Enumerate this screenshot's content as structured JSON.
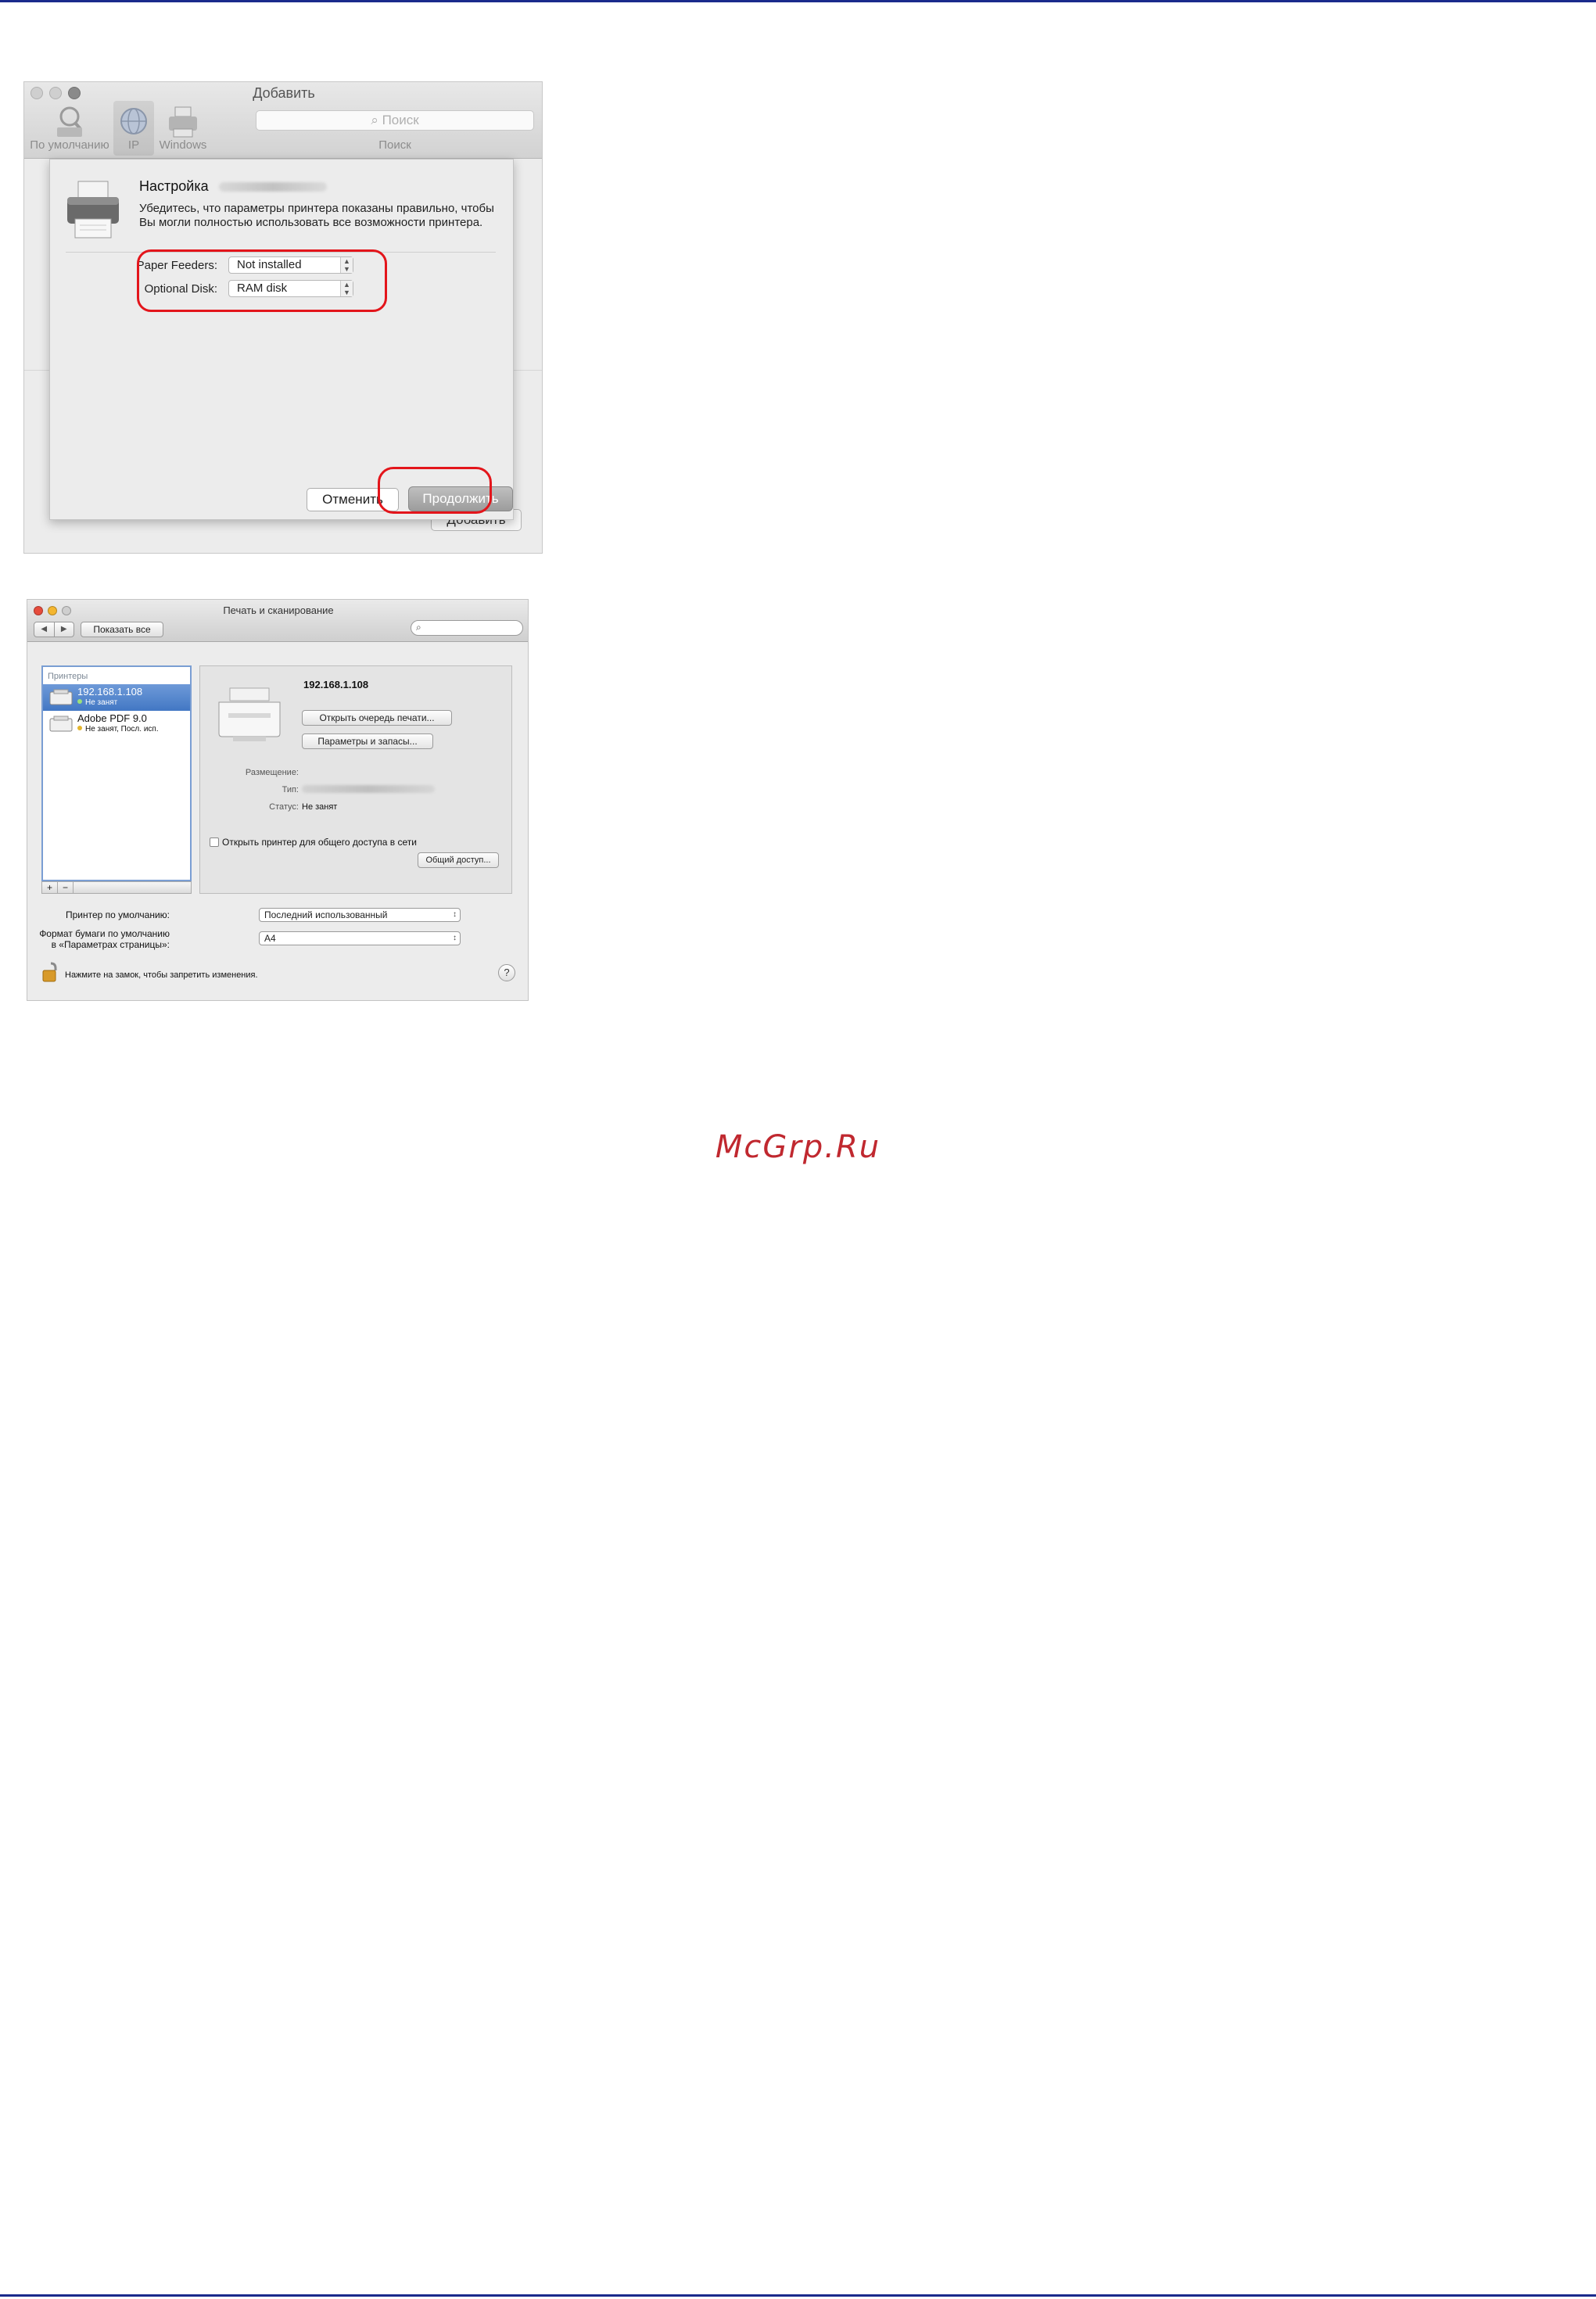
{
  "add_dialog": {
    "window_title": "Добавить",
    "toolbar": {
      "default_label": "По умолчанию",
      "ip_label": "IP",
      "windows_label": "Windows",
      "search_placeholder": "Поиск",
      "search_label": "Поиск"
    },
    "background_add_button": "Добавить",
    "sheet": {
      "title": "Настройка",
      "description": "Убедитесь, что параметры принтера показаны правильно, чтобы Вы могли полностью использовать все возможности принтера.",
      "paper_feeders_label": "Paper Feeders:",
      "paper_feeders_value": "Not installed",
      "optional_disk_label": "Optional Disk:",
      "optional_disk_value": "RAM disk",
      "cancel_button": "Отменить",
      "continue_button": "Продолжить"
    }
  },
  "print_scan": {
    "window_title": "Печать и сканирование",
    "show_all_button": "Показать все",
    "printers_header": "Принтеры",
    "printers": [
      {
        "name": "192.168.1.108",
        "status": "Не занят"
      },
      {
        "name": "Adobe PDF 9.0",
        "status": "Не занят, Посл. исп."
      }
    ],
    "detail": {
      "name": "192.168.1.108",
      "open_queue_button": "Открыть очередь печати...",
      "options_button": "Параметры и запасы...",
      "location_label": "Размещение:",
      "type_label": "Тип:",
      "status_label": "Статус:",
      "status_value": "Не занят",
      "share_checkbox_label": "Открыть принтер для общего доступа в сети",
      "sharing_button": "Общий доступ..."
    },
    "default_printer_label": "Принтер по умолчанию:",
    "default_printer_value": "Последний использованный",
    "paper_format_label_line1": "Формат бумаги по умолчанию",
    "paper_format_label_line2": "в «Параметрах страницы»:",
    "paper_format_value": "A4",
    "lock_text": "Нажмите на замок, чтобы запретить изменения.",
    "help_label": "?",
    "colors": {
      "selection": "#4a7fc9",
      "close": "#e64b3c",
      "minimize": "#f4b630",
      "zoom": "#cfcfcf"
    }
  },
  "watermark": "McGrp.Ru",
  "annotation_color": "#e3151b"
}
